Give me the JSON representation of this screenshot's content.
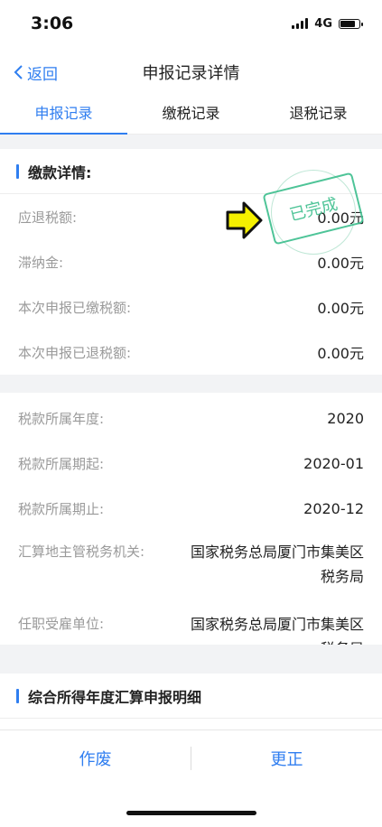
{
  "status_bar": {
    "time": "3:06",
    "network": "4G"
  },
  "nav": {
    "back_label": "返回",
    "title": "申报记录详情"
  },
  "tabs": [
    "申报记录",
    "缴税记录",
    "退税记录"
  ],
  "payment": {
    "heading": "缴款详情:",
    "rows": [
      {
        "label": "应退税额:",
        "value": "0.00元"
      },
      {
        "label": "滞纳金:",
        "value": "0.00元"
      },
      {
        "label": "本次申报已缴税额:",
        "value": "0.00元"
      },
      {
        "label": "本次申报已退税额:",
        "value": "0.00元"
      }
    ],
    "stamp_text": "已完成"
  },
  "period": {
    "rows": [
      {
        "label": "税款所属年度:",
        "value": "2020"
      },
      {
        "label": "税款所属期起:",
        "value": "2020-01"
      },
      {
        "label": "税款所属期止:",
        "value": "2020-12"
      },
      {
        "label": "汇算地主管税务机关:",
        "value": "国家税务总局厦门市集美区税务局"
      },
      {
        "label": "任职受雇单位:",
        "value": "国家税务总局厦门市集美区税务局"
      }
    ]
  },
  "detail_heading": "综合所得年度汇算申报明细",
  "bottom": {
    "void_label": "作废",
    "correct_label": "更正"
  },
  "colors": {
    "accent": "#2f7ef0",
    "stamp": "#3fbf8f",
    "arrow": "#f5f000"
  }
}
